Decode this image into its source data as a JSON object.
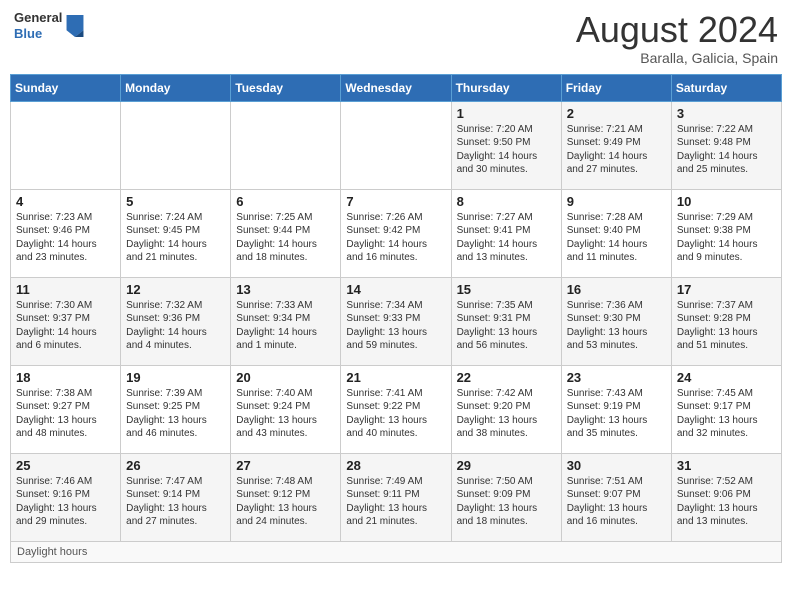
{
  "header": {
    "logo_general": "General",
    "logo_blue": "Blue",
    "month_year": "August 2024",
    "location": "Baralla, Galicia, Spain"
  },
  "days_of_week": [
    "Sunday",
    "Monday",
    "Tuesday",
    "Wednesday",
    "Thursday",
    "Friday",
    "Saturday"
  ],
  "weeks": [
    {
      "days": [
        {
          "num": "",
          "info": ""
        },
        {
          "num": "",
          "info": ""
        },
        {
          "num": "",
          "info": ""
        },
        {
          "num": "",
          "info": ""
        },
        {
          "num": "1",
          "info": "Sunrise: 7:20 AM\nSunset: 9:50 PM\nDaylight: 14 hours and 30 minutes."
        },
        {
          "num": "2",
          "info": "Sunrise: 7:21 AM\nSunset: 9:49 PM\nDaylight: 14 hours and 27 minutes."
        },
        {
          "num": "3",
          "info": "Sunrise: 7:22 AM\nSunset: 9:48 PM\nDaylight: 14 hours and 25 minutes."
        }
      ]
    },
    {
      "days": [
        {
          "num": "4",
          "info": "Sunrise: 7:23 AM\nSunset: 9:46 PM\nDaylight: 14 hours and 23 minutes."
        },
        {
          "num": "5",
          "info": "Sunrise: 7:24 AM\nSunset: 9:45 PM\nDaylight: 14 hours and 21 minutes."
        },
        {
          "num": "6",
          "info": "Sunrise: 7:25 AM\nSunset: 9:44 PM\nDaylight: 14 hours and 18 minutes."
        },
        {
          "num": "7",
          "info": "Sunrise: 7:26 AM\nSunset: 9:42 PM\nDaylight: 14 hours and 16 minutes."
        },
        {
          "num": "8",
          "info": "Sunrise: 7:27 AM\nSunset: 9:41 PM\nDaylight: 14 hours and 13 minutes."
        },
        {
          "num": "9",
          "info": "Sunrise: 7:28 AM\nSunset: 9:40 PM\nDaylight: 14 hours and 11 minutes."
        },
        {
          "num": "10",
          "info": "Sunrise: 7:29 AM\nSunset: 9:38 PM\nDaylight: 14 hours and 9 minutes."
        }
      ]
    },
    {
      "days": [
        {
          "num": "11",
          "info": "Sunrise: 7:30 AM\nSunset: 9:37 PM\nDaylight: 14 hours and 6 minutes."
        },
        {
          "num": "12",
          "info": "Sunrise: 7:32 AM\nSunset: 9:36 PM\nDaylight: 14 hours and 4 minutes."
        },
        {
          "num": "13",
          "info": "Sunrise: 7:33 AM\nSunset: 9:34 PM\nDaylight: 14 hours and 1 minute."
        },
        {
          "num": "14",
          "info": "Sunrise: 7:34 AM\nSunset: 9:33 PM\nDaylight: 13 hours and 59 minutes."
        },
        {
          "num": "15",
          "info": "Sunrise: 7:35 AM\nSunset: 9:31 PM\nDaylight: 13 hours and 56 minutes."
        },
        {
          "num": "16",
          "info": "Sunrise: 7:36 AM\nSunset: 9:30 PM\nDaylight: 13 hours and 53 minutes."
        },
        {
          "num": "17",
          "info": "Sunrise: 7:37 AM\nSunset: 9:28 PM\nDaylight: 13 hours and 51 minutes."
        }
      ]
    },
    {
      "days": [
        {
          "num": "18",
          "info": "Sunrise: 7:38 AM\nSunset: 9:27 PM\nDaylight: 13 hours and 48 minutes."
        },
        {
          "num": "19",
          "info": "Sunrise: 7:39 AM\nSunset: 9:25 PM\nDaylight: 13 hours and 46 minutes."
        },
        {
          "num": "20",
          "info": "Sunrise: 7:40 AM\nSunset: 9:24 PM\nDaylight: 13 hours and 43 minutes."
        },
        {
          "num": "21",
          "info": "Sunrise: 7:41 AM\nSunset: 9:22 PM\nDaylight: 13 hours and 40 minutes."
        },
        {
          "num": "22",
          "info": "Sunrise: 7:42 AM\nSunset: 9:20 PM\nDaylight: 13 hours and 38 minutes."
        },
        {
          "num": "23",
          "info": "Sunrise: 7:43 AM\nSunset: 9:19 PM\nDaylight: 13 hours and 35 minutes."
        },
        {
          "num": "24",
          "info": "Sunrise: 7:45 AM\nSunset: 9:17 PM\nDaylight: 13 hours and 32 minutes."
        }
      ]
    },
    {
      "days": [
        {
          "num": "25",
          "info": "Sunrise: 7:46 AM\nSunset: 9:16 PM\nDaylight: 13 hours and 29 minutes."
        },
        {
          "num": "26",
          "info": "Sunrise: 7:47 AM\nSunset: 9:14 PM\nDaylight: 13 hours and 27 minutes."
        },
        {
          "num": "27",
          "info": "Sunrise: 7:48 AM\nSunset: 9:12 PM\nDaylight: 13 hours and 24 minutes."
        },
        {
          "num": "28",
          "info": "Sunrise: 7:49 AM\nSunset: 9:11 PM\nDaylight: 13 hours and 21 minutes."
        },
        {
          "num": "29",
          "info": "Sunrise: 7:50 AM\nSunset: 9:09 PM\nDaylight: 13 hours and 18 minutes."
        },
        {
          "num": "30",
          "info": "Sunrise: 7:51 AM\nSunset: 9:07 PM\nDaylight: 13 hours and 16 minutes."
        },
        {
          "num": "31",
          "info": "Sunrise: 7:52 AM\nSunset: 9:06 PM\nDaylight: 13 hours and 13 minutes."
        }
      ]
    }
  ],
  "note": "Daylight hours"
}
